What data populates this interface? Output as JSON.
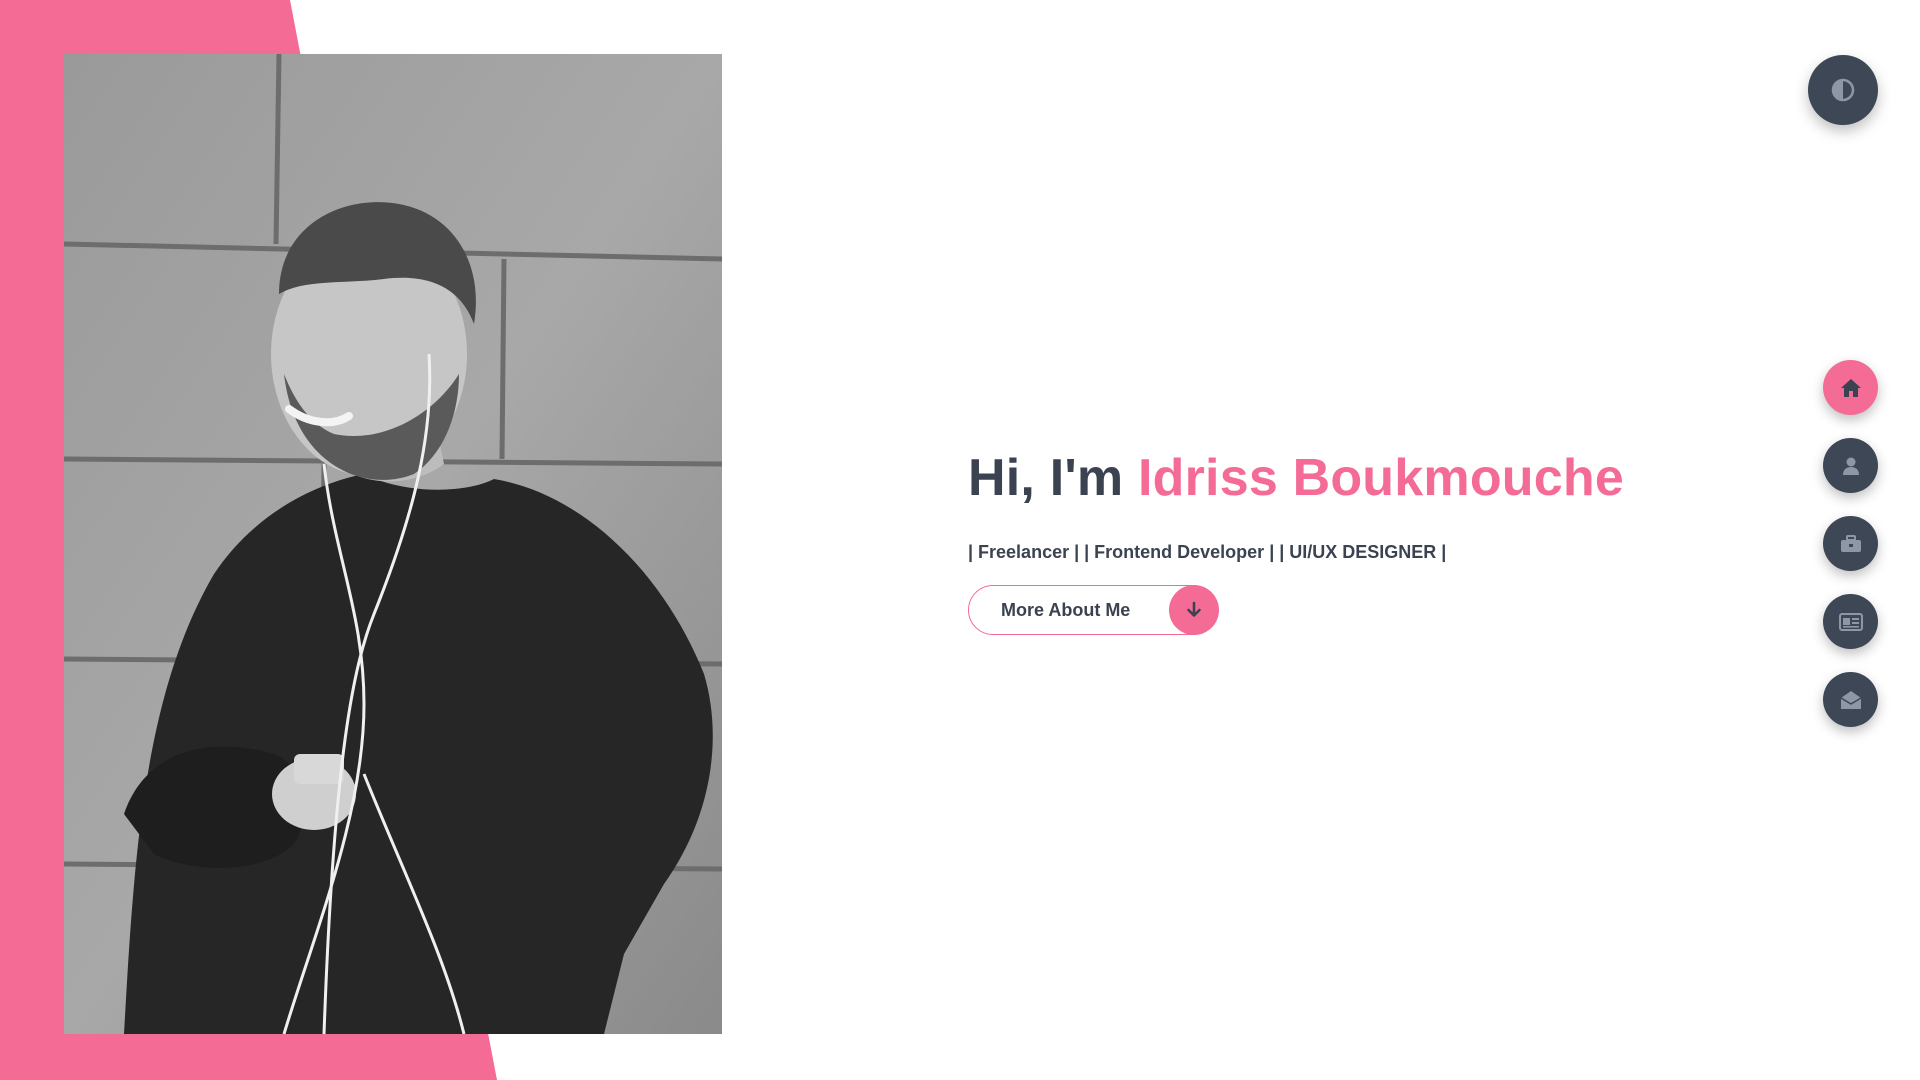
{
  "colors": {
    "accent": "#f46b96",
    "dark": "#3b4351",
    "button_dark": "#3e4756",
    "background": "#ffffff"
  },
  "hero": {
    "greeting": "Hi, I'm ",
    "name": "Idriss Boukmouche",
    "tagline": "| Freelancer | | Frontend Developer | | UI/UX DESIGNER |",
    "cta_label": "More About Me",
    "cta_icon": "arrow-down-icon"
  },
  "profile_image": {
    "alt": "portrait photo",
    "style": "grayscale"
  },
  "theme_toggle": {
    "icon": "half-circle-contrast-icon"
  },
  "nav": {
    "items": [
      {
        "id": "home",
        "icon": "home-icon",
        "active": true
      },
      {
        "id": "about",
        "icon": "user-icon",
        "active": false
      },
      {
        "id": "portfolio",
        "icon": "briefcase-icon",
        "active": false
      },
      {
        "id": "blog",
        "icon": "newspaper-icon",
        "active": false
      },
      {
        "id": "contact",
        "icon": "envelope-open-icon",
        "active": false
      }
    ]
  }
}
